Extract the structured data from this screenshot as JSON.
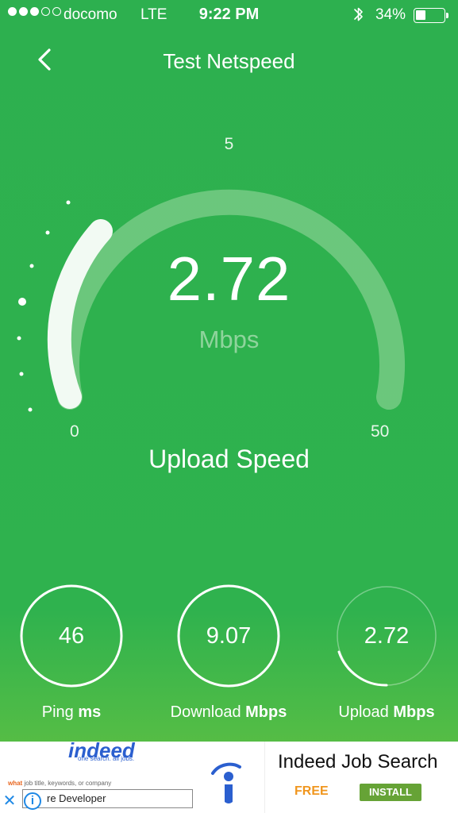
{
  "status_bar": {
    "carrier": "docomo",
    "network": "LTE",
    "time": "9:22 PM",
    "battery_percent": "34%",
    "battery_level": 0.34
  },
  "nav": {
    "title": "Test Netspeed",
    "back_icon": "chevron-left-icon"
  },
  "gauge": {
    "value": "2.72",
    "unit": "Mbps",
    "tick_top": "5",
    "tick_min": "0",
    "tick_max": "50",
    "mode_title": "Upload Speed"
  },
  "stats": [
    {
      "value": "46",
      "label": "Ping",
      "unit": "ms"
    },
    {
      "value": "9.07",
      "label": "Download",
      "unit": "Mbps"
    },
    {
      "value": "2.72",
      "label": "Upload",
      "unit": "Mbps"
    }
  ],
  "ad": {
    "logo": "indeed",
    "tagline": "one search. all jobs.",
    "what_label": "what",
    "what_hint": "job title, keywords, or company",
    "field_value": "re Developer",
    "app_title": "Indeed Job Search",
    "price": "FREE",
    "install_label": "INSTALL",
    "close_icon": "close-icon",
    "info_icon": "info-icon"
  },
  "colors": {
    "background": "#2db04f",
    "ad_install": "#66a336",
    "ad_free": "#f0961e",
    "ad_brand": "#2b5fcf"
  }
}
